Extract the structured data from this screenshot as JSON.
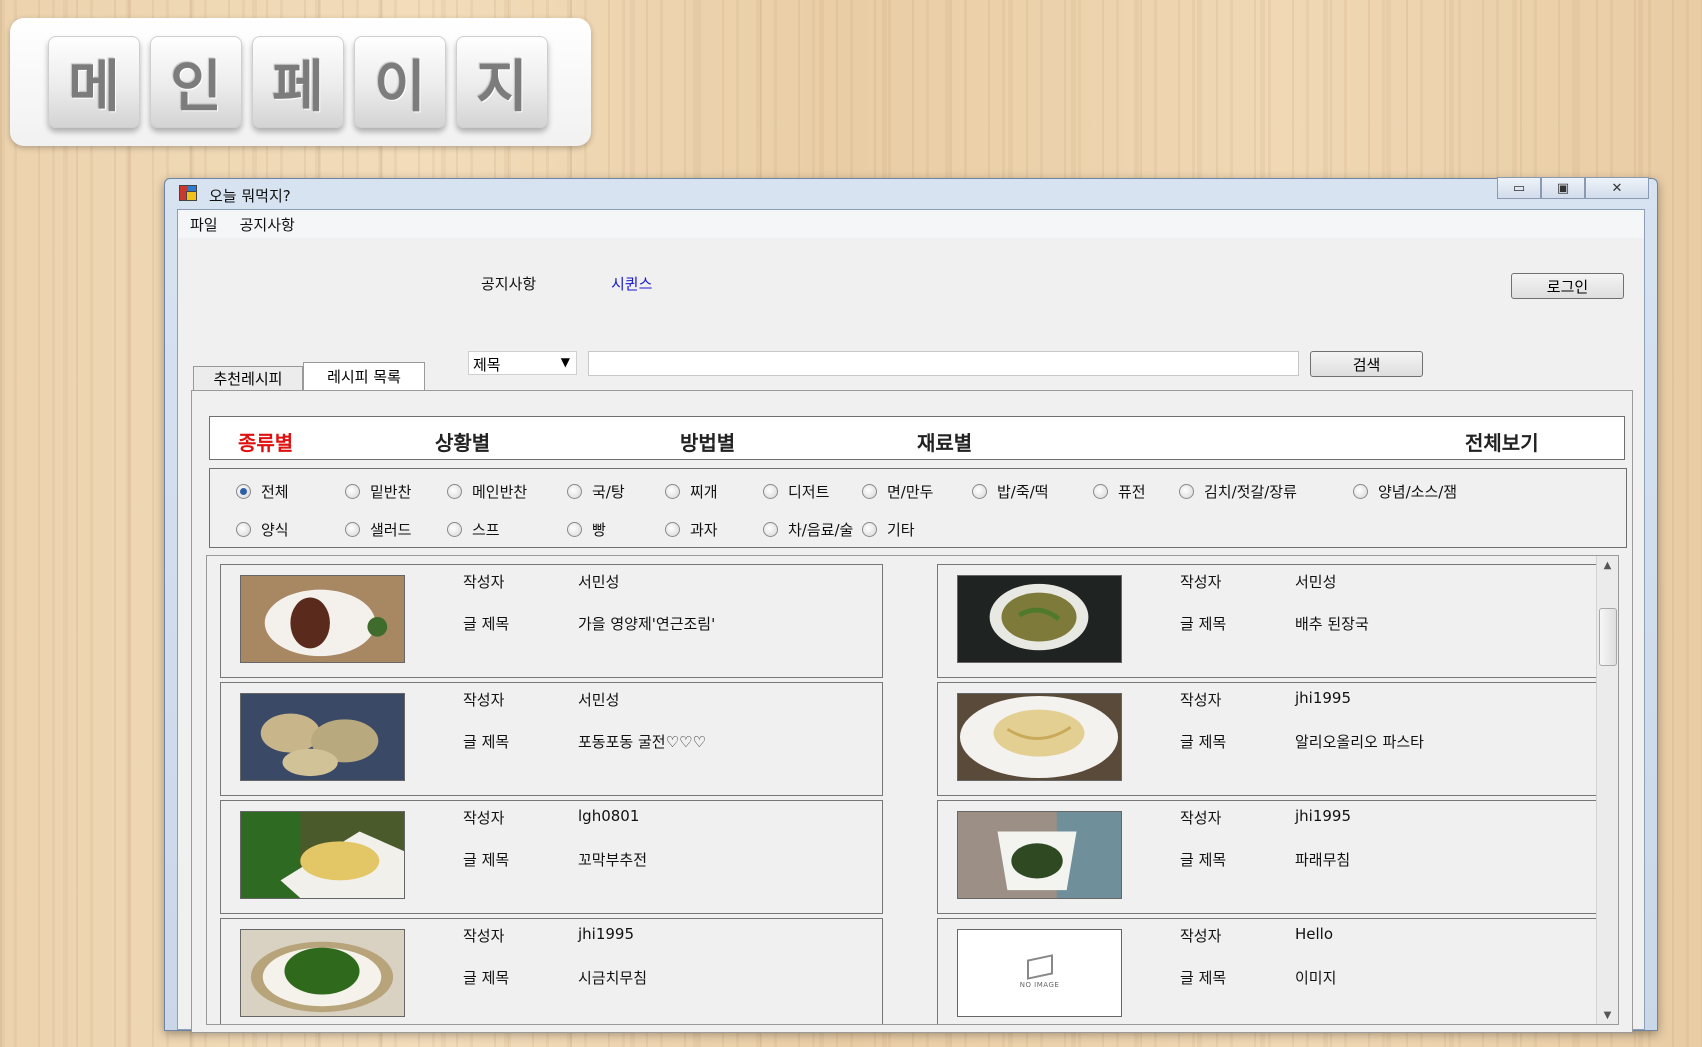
{
  "banner": {
    "chars": [
      "메",
      "인",
      "페",
      "이",
      "지"
    ]
  },
  "window": {
    "title": "오늘 뭐먹지?",
    "caption": {
      "minimize": "▭",
      "maximize": "▣",
      "close": "✕"
    }
  },
  "menu": {
    "file": "파일",
    "notice": "공지사항"
  },
  "header": {
    "notice_label": "공지사항",
    "sequins_link": "시퀸스",
    "login_button": "로그인"
  },
  "tabs": {
    "recommended": "추천레시피",
    "recipe_list": "레시피 목록"
  },
  "search": {
    "field": "제목",
    "arrow": "▼",
    "value": "",
    "button": "검색"
  },
  "categories": {
    "type": "종류별",
    "situation": "상황별",
    "method": "방법별",
    "ingredient": "재료별",
    "all": "전체보기"
  },
  "filters": [
    "전체",
    "밑반찬",
    "메인반찬",
    "국/탕",
    "찌개",
    "디저트",
    "면/만두",
    "밥/죽/떡",
    "퓨전",
    "김치/젓갈/장류",
    "양념/소스/잼",
    "양식",
    "샐러드",
    "스프",
    "빵",
    "과자",
    "차/음료/술",
    "기타"
  ],
  "selected_filter": "전체",
  "card_labels": {
    "author": "작성자",
    "title": "글 제목"
  },
  "recipes": [
    {
      "author": "서민성",
      "title": "가을 영양제'연근조림'",
      "image": "lotus-root-dish"
    },
    {
      "author": "서민성",
      "title": "배추 된장국",
      "image": "cabbage-soup"
    },
    {
      "author": "서민성",
      "title": "포동포동 굴전♡♡♡",
      "image": "oyster-pancake"
    },
    {
      "author": "jhi1995",
      "title": "알리오올리오 파스타",
      "image": "aglio-olio-pasta"
    },
    {
      "author": "lgh0801",
      "title": "꼬막부추전",
      "image": "cockle-chive-pancake"
    },
    {
      "author": "jhi1995",
      "title": "파래무침",
      "image": "seaweed-salad"
    },
    {
      "author": "jhi1995",
      "title": "시금치무침",
      "image": "spinach-namul"
    },
    {
      "author": "Hello",
      "title": "이미지",
      "image": "no-image"
    }
  ],
  "no_image_text": "NO IMAGE",
  "scrollbar": {
    "up": "▲",
    "down": "▼"
  }
}
